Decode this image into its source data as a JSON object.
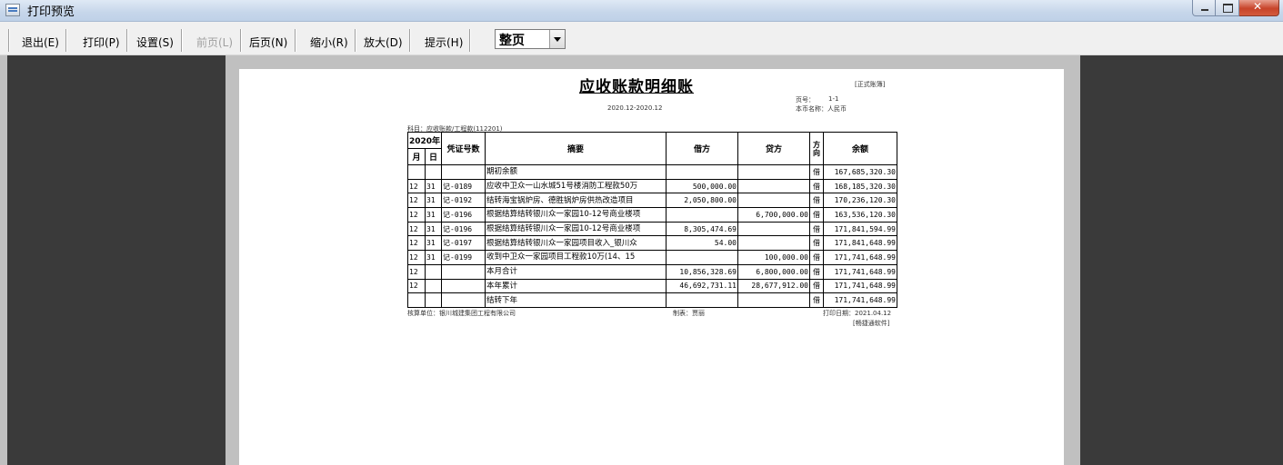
{
  "window": {
    "title": "打印预览"
  },
  "toolbar": {
    "exit": "退出(E)",
    "print": "打印(P)",
    "settings": "设置(S)",
    "prev": "前页(L)",
    "next": "后页(N)",
    "zoom_out": "缩小(R)",
    "zoom_in": "放大(D)",
    "hint": "提示(H)",
    "zoom_value": "整页"
  },
  "doc": {
    "title": "应收账款明细账",
    "badge": "[正式账簿]",
    "page_label": "页号：",
    "page_value": "1-1",
    "period": "2020.12-2020.12",
    "currency": "本币名称：人民币",
    "subject": "科目：应收账款/工程款(112201)",
    "header": {
      "year": "2020年",
      "month": "月",
      "day": "日",
      "voucher": "凭证号数",
      "summary": "摘要",
      "debit": "借方",
      "credit": "贷方",
      "direction": "方向",
      "balance": "余额"
    },
    "rows": [
      {
        "m": "",
        "d": "",
        "v": "",
        "s": "期初余额",
        "dr": "",
        "cr": "",
        "dir": "借",
        "bal": "167,685,320.30"
      },
      {
        "m": "12",
        "d": "31",
        "v": "记-0189",
        "s": "应收中卫众一山水城51号楼消防工程款50万",
        "dr": "500,000.00",
        "cr": "",
        "dir": "借",
        "bal": "168,185,320.30"
      },
      {
        "m": "12",
        "d": "31",
        "v": "记-0192",
        "s": "结转海宝锅炉房、德胜锅炉房供热改造项目",
        "dr": "2,050,800.00",
        "cr": "",
        "dir": "借",
        "bal": "170,236,120.30"
      },
      {
        "m": "12",
        "d": "31",
        "v": "记-0196",
        "s": "根据结算结转银川众一家园10-12号商业楼项",
        "dr": "",
        "cr": "6,700,000.00",
        "dir": "借",
        "bal": "163,536,120.30"
      },
      {
        "m": "12",
        "d": "31",
        "v": "记-0196",
        "s": "根据结算结转银川众一家园10-12号商业楼项",
        "dr": "8,305,474.69",
        "cr": "",
        "dir": "借",
        "bal": "171,841,594.99"
      },
      {
        "m": "12",
        "d": "31",
        "v": "记-0197",
        "s": "根据结算结转银川众一家园项目收入_银川众",
        "dr": "54.00",
        "cr": "",
        "dir": "借",
        "bal": "171,841,648.99"
      },
      {
        "m": "12",
        "d": "31",
        "v": "记-0199",
        "s": "收到中卫众一家园项目工程款10万(14、15",
        "dr": "",
        "cr": "100,000.00",
        "dir": "借",
        "bal": "171,741,648.99"
      },
      {
        "m": "12",
        "d": "",
        "v": "",
        "s": "本月合计",
        "dr": "10,856,328.69",
        "cr": "6,800,000.00",
        "dir": "借",
        "bal": "171,741,648.99"
      },
      {
        "m": "12",
        "d": "",
        "v": "",
        "s": "本年累计",
        "dr": "46,692,731.11",
        "cr": "28,677,912.00",
        "dir": "借",
        "bal": "171,741,648.99"
      },
      {
        "m": "",
        "d": "",
        "v": "",
        "s": "结转下年",
        "dr": "",
        "cr": "",
        "dir": "借",
        "bal": "171,741,648.99"
      }
    ],
    "footer": {
      "unit": "核算单位：银川城建集团工程有限公司",
      "maker": "制表：贾丽",
      "print_date": "打印日期：2021.04.12",
      "software": "[畅捷通软件]"
    }
  }
}
